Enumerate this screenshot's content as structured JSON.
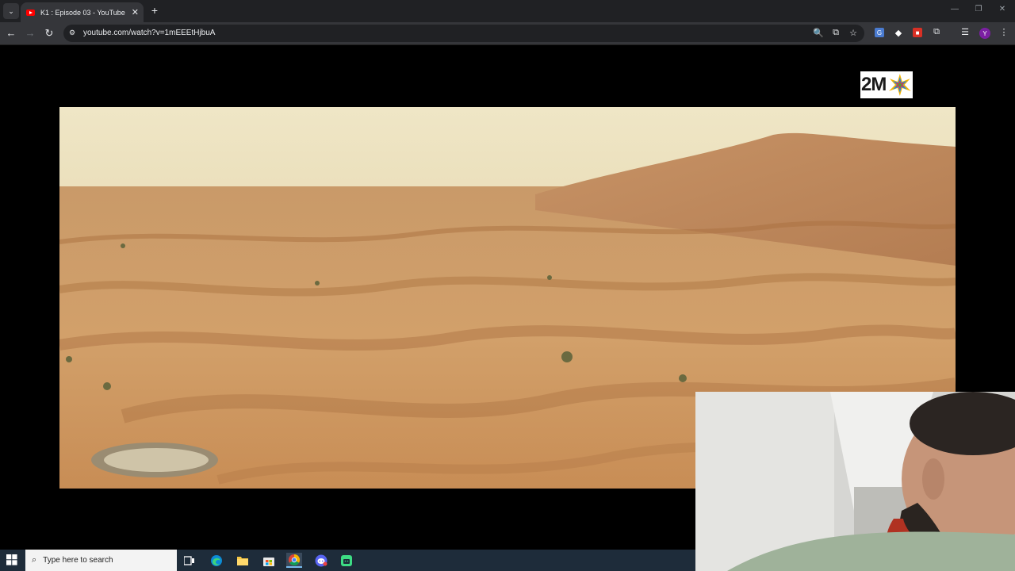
{
  "browser": {
    "tab": {
      "title": "K1 : Episode 03 - YouTube",
      "close_glyph": "✕",
      "favicon": "youtube-icon"
    },
    "tab_search_glyph": "⌄",
    "new_tab_glyph": "+",
    "window_controls": {
      "minimize": "—",
      "restore": "❐",
      "close": "✕"
    },
    "nav": {
      "back": "←",
      "forward": "→",
      "reload": "↻"
    },
    "address": {
      "url": "youtube.com/watch?v=1mEEEtHjbuA",
      "site_info_glyph": "⚙"
    },
    "omnibox_icons": {
      "zoom": "🔍",
      "install": "⧉",
      "bookmark": "☆"
    },
    "extensions": [
      {
        "name": "translate-extension-icon",
        "glyph": "G",
        "color": "#4a7bd0"
      },
      {
        "name": "diamond-extension-icon",
        "glyph": "◆",
        "color": "#35363a"
      },
      {
        "name": "red-extension-icon",
        "glyph": "■",
        "color": "#d93025"
      }
    ],
    "toolbar_icons": {
      "extensions": "⧉",
      "reading_list": "☰",
      "menu": "⋮"
    },
    "profile_initial": "Y"
  },
  "video": {
    "channel_logo_text": "2M",
    "colors": {
      "sky": "#e8dcb8",
      "sand_light": "#d2a16a",
      "sand_dark": "#a8703f"
    }
  },
  "taskbar": {
    "search_placeholder": "Type here to search",
    "search_icon": "search-icon",
    "apps": [
      "task-view-icon",
      "edge-icon",
      "file-explorer-icon",
      "store-icon",
      "chrome-icon",
      "discord-icon",
      "android-app-icon"
    ]
  }
}
